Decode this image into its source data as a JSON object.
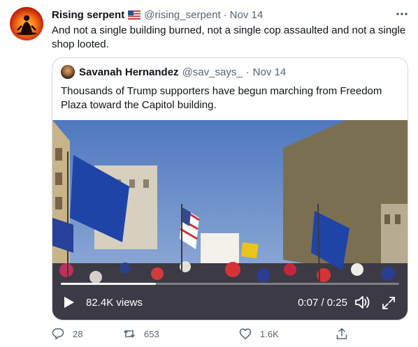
{
  "tweet": {
    "display_name": "Rising serpent",
    "handle": "@rising_serpent",
    "separator": "·",
    "timestamp": "Nov 14",
    "text": "And not a single building burned, not a single cop assaulted and not a single shop looted."
  },
  "quoted_tweet": {
    "display_name": "Savanah Hernandez",
    "handle": "@sav_says_",
    "separator": "·",
    "timestamp": "Nov 14",
    "text": "Thousands of Trump supporters have begun marching from Freedom Plaza toward the Capitol building."
  },
  "video": {
    "views": "82.4K views",
    "time": "0:07 / 0:25",
    "progress_fraction": 0.28
  },
  "actions": {
    "replies": "28",
    "retweets": "653",
    "likes": "1.6K"
  },
  "colors": {
    "text_primary": "#0f1419",
    "text_secondary": "#536471",
    "border": "#cfd9de"
  },
  "icons": {
    "flag": "us-flag-icon",
    "more": "more-options-icon",
    "reply": "reply-icon",
    "retweet": "retweet-icon",
    "like": "heart-icon",
    "share": "share-icon",
    "play": "play-icon",
    "volume": "volume-icon",
    "fullscreen": "fullscreen-icon"
  }
}
